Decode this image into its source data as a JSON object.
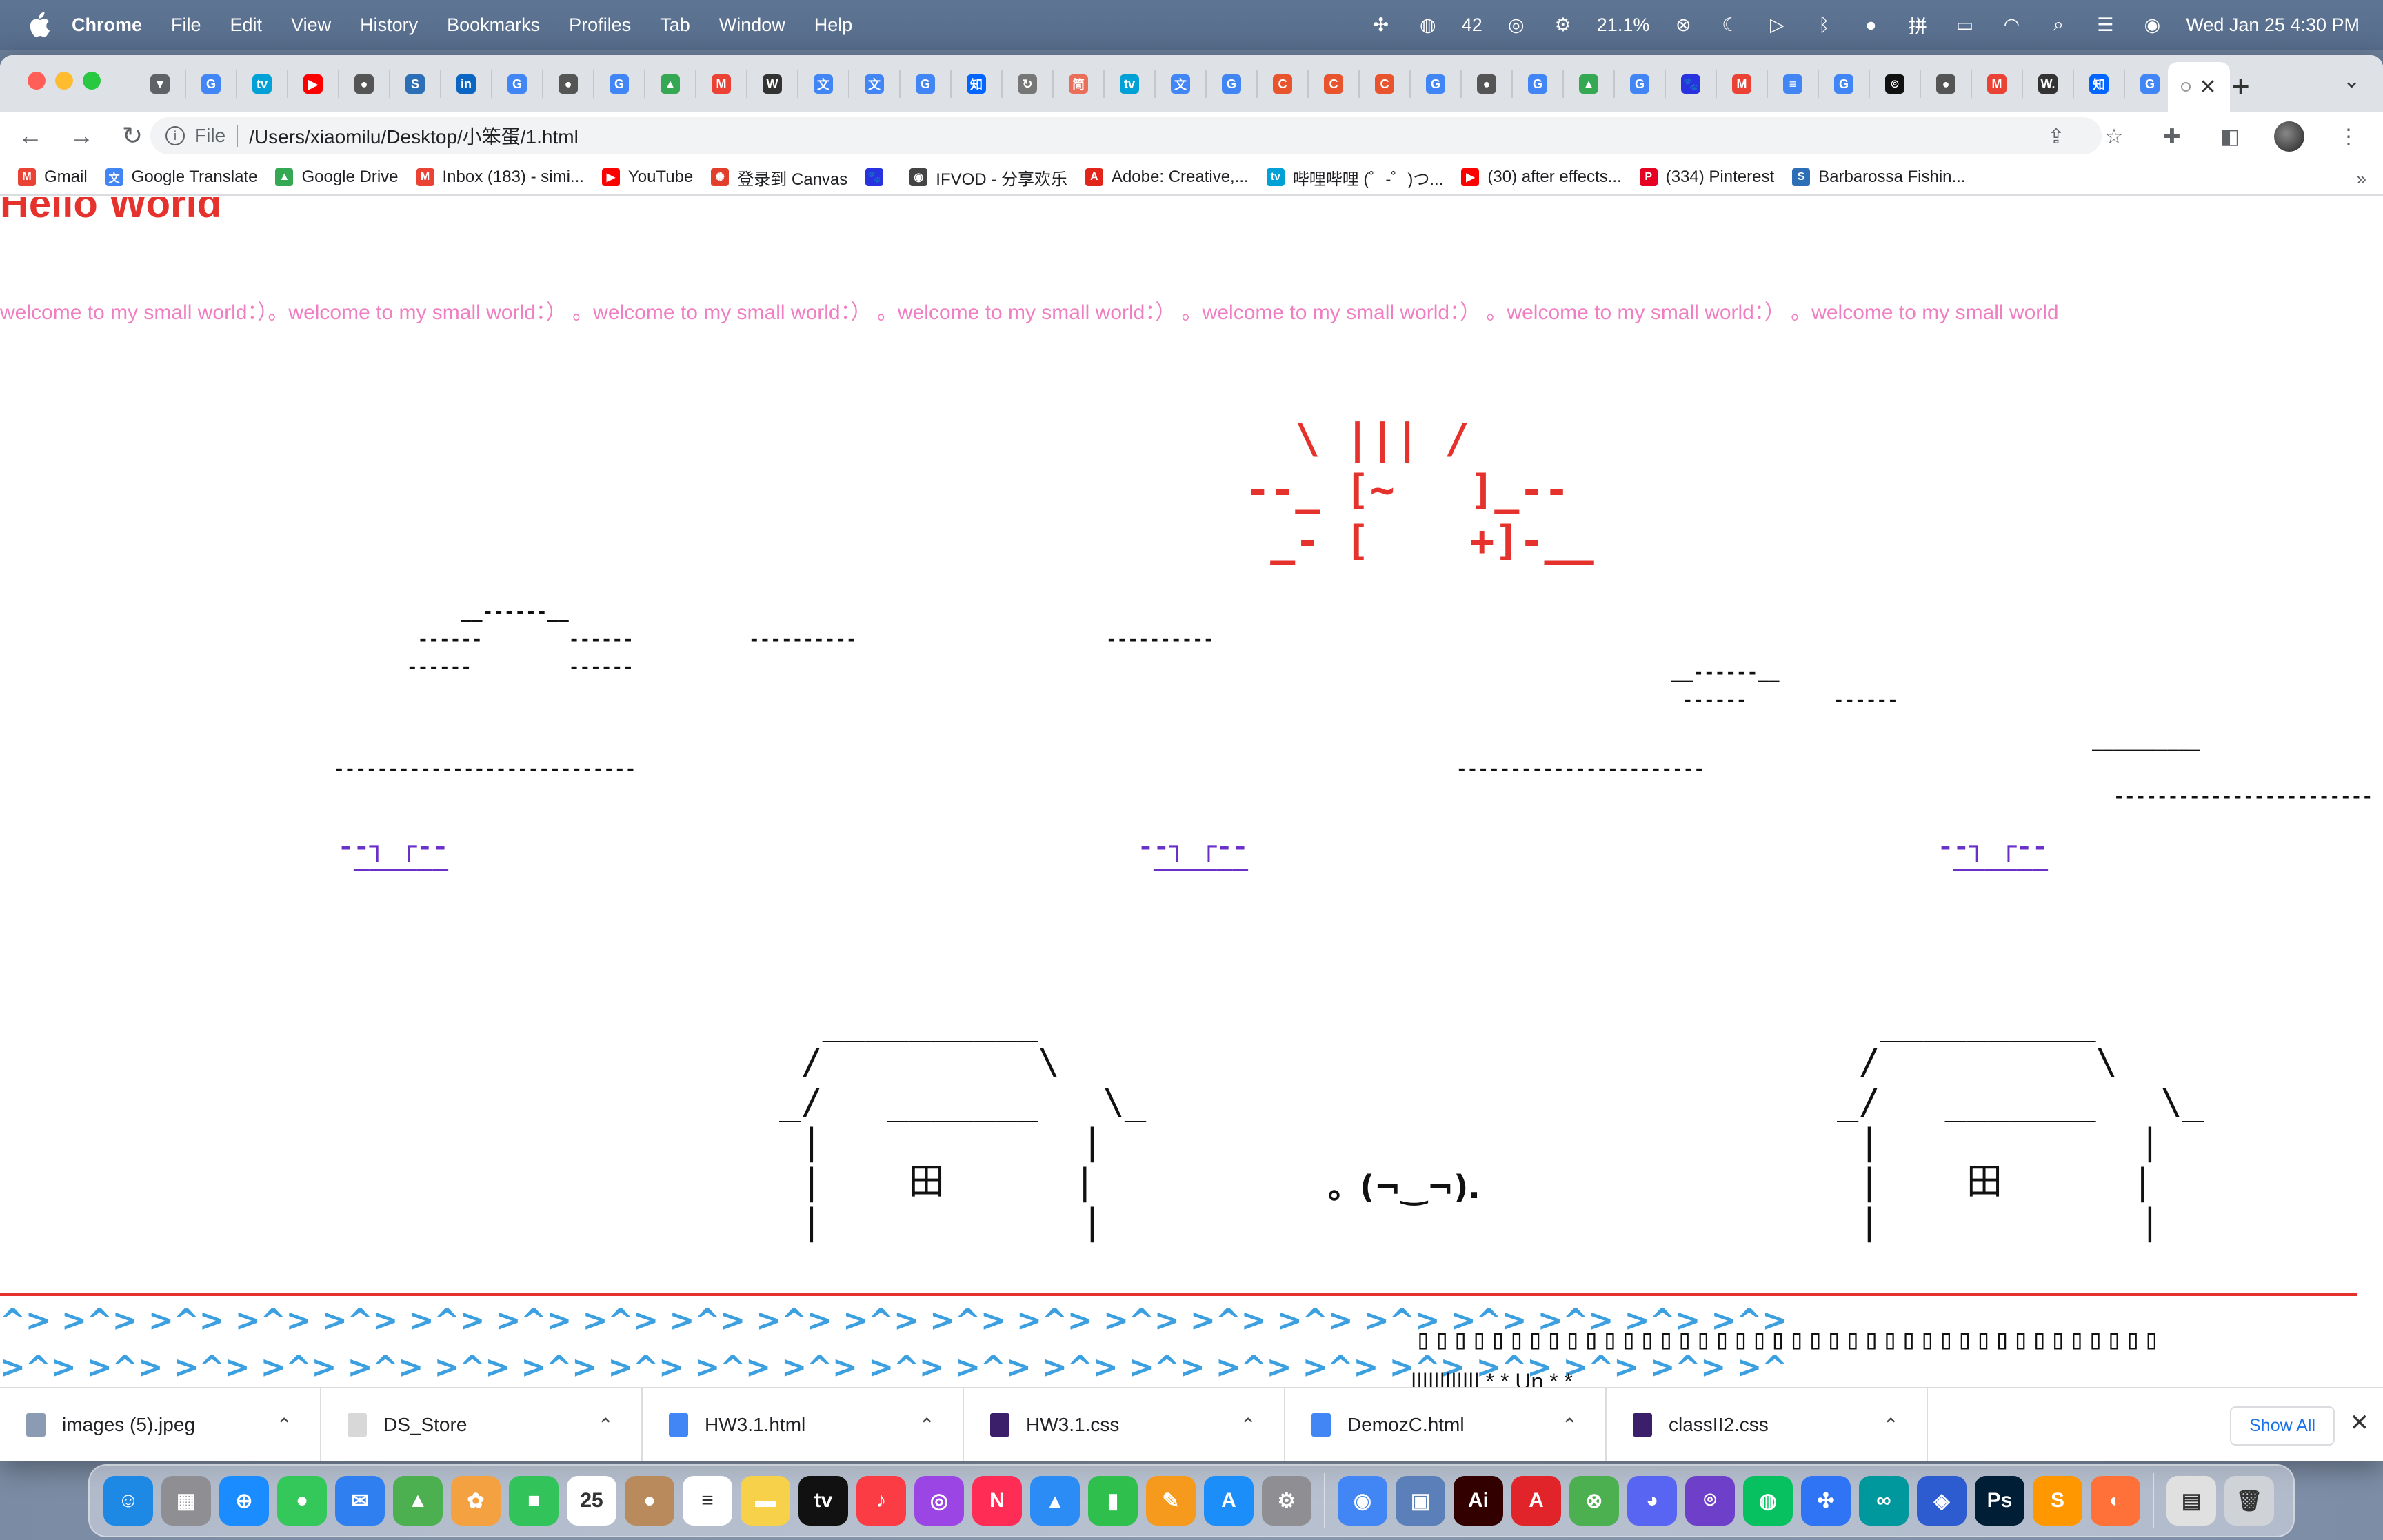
{
  "menubar": {
    "app": "Chrome",
    "items": [
      "File",
      "Edit",
      "View",
      "History",
      "Bookmarks",
      "Profiles",
      "Tab",
      "Window",
      "Help"
    ],
    "wechat_count": "42",
    "cpu": "21.1%",
    "datetime": "Wed Jan 25  4:30 PM"
  },
  "tabs": {
    "favicons": [
      {
        "label": "▼",
        "color": "#5f6368"
      },
      {
        "label": "G",
        "color": "#4285f4"
      },
      {
        "label": "tv",
        "color": "#00a1d6"
      },
      {
        "label": "▶",
        "color": "#ff0000"
      },
      {
        "label": "●",
        "color": "#555"
      },
      {
        "label": "S",
        "color": "#2d6fb7"
      },
      {
        "label": "in",
        "color": "#0a66c2"
      },
      {
        "label": "G",
        "color": "#4285f4"
      },
      {
        "label": "●",
        "color": "#555"
      },
      {
        "label": "G",
        "color": "#4285f4"
      },
      {
        "label": "▲",
        "color": "#34a853"
      },
      {
        "label": "M",
        "color": "#ea4335"
      },
      {
        "label": "W",
        "color": "#333"
      },
      {
        "label": "文",
        "color": "#4285f4"
      },
      {
        "label": "文",
        "color": "#4285f4"
      },
      {
        "label": "G",
        "color": "#4285f4"
      },
      {
        "label": "知",
        "color": "#0066ff"
      },
      {
        "label": "↻",
        "color": "#777"
      },
      {
        "label": "简",
        "color": "#ea6f5a"
      },
      {
        "label": "tv",
        "color": "#00a1d6"
      },
      {
        "label": "文",
        "color": "#4285f4"
      },
      {
        "label": "G",
        "color": "#4285f4"
      },
      {
        "label": "C",
        "color": "#e8542d"
      },
      {
        "label": "C",
        "color": "#e8542d"
      },
      {
        "label": "C",
        "color": "#e8542d"
      },
      {
        "label": "G",
        "color": "#4285f4"
      },
      {
        "label": "●",
        "color": "#555"
      },
      {
        "label": "G",
        "color": "#4285f4"
      },
      {
        "label": "▲",
        "color": "#34a853"
      },
      {
        "label": "G",
        "color": "#4285f4"
      },
      {
        "label": "🐾",
        "color": "#2932e1"
      },
      {
        "label": "M",
        "color": "#ea4335"
      },
      {
        "label": "≡",
        "color": "#4285f4"
      },
      {
        "label": "G",
        "color": "#4285f4"
      },
      {
        "label": "⌾",
        "color": "#111"
      },
      {
        "label": "●",
        "color": "#555"
      },
      {
        "label": "M",
        "color": "#ea4335"
      },
      {
        "label": "W.",
        "color": "#333"
      },
      {
        "label": "知",
        "color": "#0066ff"
      },
      {
        "label": "G",
        "color": "#4285f4"
      }
    ]
  },
  "toolbar": {
    "scheme": "File",
    "url": "/Users/xiaomilu/Desktop/小笨蛋/1.html"
  },
  "bookmarks": [
    {
      "label": "Gmail",
      "icon": "M",
      "color": "#ea4335"
    },
    {
      "label": "Google Translate",
      "icon": "文",
      "color": "#4285f4"
    },
    {
      "label": "Google Drive",
      "icon": "▲",
      "color": "#34a853"
    },
    {
      "label": "Inbox (183) - simi...",
      "icon": "M",
      "color": "#ea4335"
    },
    {
      "label": "YouTube",
      "icon": "▶",
      "color": "#ff0000"
    },
    {
      "label": "登录到 Canvas",
      "icon": "✺",
      "color": "#e13f2b"
    },
    {
      "label": "",
      "icon": "🐾",
      "color": "#2932e1"
    },
    {
      "label": "IFVOD - 分享欢乐",
      "icon": "◉",
      "color": "#444"
    },
    {
      "label": "Adobe: Creative,...",
      "icon": "A",
      "color": "#e1251b"
    },
    {
      "label": "哔哩哔哩 (゜-゜)つ...",
      "icon": "tv",
      "color": "#00a1d6"
    },
    {
      "label": "(30) after effects...",
      "icon": "▶",
      "color": "#ff0000"
    },
    {
      "label": "(334) Pinterest",
      "icon": "P",
      "color": "#e60023"
    },
    {
      "label": "Barbarossa Fishin...",
      "icon": "S",
      "color": "#2d6fb7"
    }
  ],
  "page": {
    "title": "Hello World",
    "marquee": "welcome to my small world：）。welcome to my small world：）  。welcome to my small world：）  。welcome to my small world：）  。welcome to my small world：）  。welcome to my small world：）  。welcome to my small world",
    "sun": "  \\ ||| /\n--_ [~   ]_--\n _- [    +]-__",
    "cloud1": "     __------__\n ------        ------\n------         ------",
    "cloud2": "----------",
    "cloud3": "----------",
    "cloud4": "__------__\n ------        ------",
    "ground1": "----------------------------",
    "ground2": "-----------------------",
    "ground3": "__________\n\n  ------------------------",
    "bird": "--┐ ┌--\n ‾‾‾‾‾‾",
    "house": "  __________\n /          \\\n_/   _______   \\_\n |            |\n |    田      |\n |            |",
    "face": "。(¬‿¬).",
    "carets1": "^> >^> >^> >^> >^> >^> >^> >^> >^> >^> >^> >^> >^> >^> >^> >^> >^> >^> >^> >^> >^>",
    "carets2": ">^> >^> >^> >^> >^> >^> >^> >^> >^> >^> >^> >^> >^> >^> >^> >^> >^> >^> >^> >^> >^",
    "carets3": "^%^ ^$^ ^#^ ^@^ ^!^ ^&^ ^%^ ^$^ ^#^ ^@^ ^!^ ^&^ ^%^ ^$^ ^#^ ^@^ ^!^ ^&^ ^%^ ^$^",
    "boxes": "▯▯▯▯▯▯▯▯▯▯▯▯▯▯▯▯▯▯▯▯▯▯▯▯▯▯▯▯▯▯▯▯▯▯▯▯▯▯▯▯",
    "pipes": "|||||||||||| * * Un * *"
  },
  "downloads": {
    "items": [
      {
        "name": "images (5).jpeg",
        "color": "#8a9bb3"
      },
      {
        "name": "DS_Store",
        "color": "#d8d8d8"
      },
      {
        "name": "HW3.1.html",
        "color": "#4285f4"
      },
      {
        "name": "HW3.1.css",
        "color": "#3b1f6b"
      },
      {
        "name": "DemozC.html",
        "color": "#4285f4"
      },
      {
        "name": "classII2.css",
        "color": "#3b1f6b"
      }
    ],
    "show_all": "Show All"
  },
  "dock": {
    "apps": [
      {
        "name": "finder",
        "label": "☺",
        "color": "#1e88e5"
      },
      {
        "name": "launchpad",
        "label": "▦",
        "color": "#8e8e93"
      },
      {
        "name": "safari",
        "label": "⊕",
        "color": "#1a8cff"
      },
      {
        "name": "messages",
        "label": "●",
        "color": "#34c759"
      },
      {
        "name": "mail",
        "label": "✉",
        "color": "#2f7ff0"
      },
      {
        "name": "maps",
        "label": "▲",
        "color": "#4caf50"
      },
      {
        "name": "photos",
        "label": "✿",
        "color": "#f4a142"
      },
      {
        "name": "facetime",
        "label": "■",
        "color": "#32c45a"
      },
      {
        "name": "calendar",
        "label": "25",
        "color": "#ffffff"
      },
      {
        "name": "contacts",
        "label": "●",
        "color": "#b98a5b"
      },
      {
        "name": "reminders",
        "label": "≡",
        "color": "#ffffff"
      },
      {
        "name": "notes",
        "label": "▬",
        "color": "#f7d14a"
      },
      {
        "name": "tv",
        "label": "tv",
        "color": "#111111"
      },
      {
        "name": "music",
        "label": "♪",
        "color": "#fc3c44"
      },
      {
        "name": "podcasts",
        "label": "◎",
        "color": "#9b45e4"
      },
      {
        "name": "news",
        "label": "N",
        "color": "#ff2d55"
      },
      {
        "name": "keynote",
        "label": "▴",
        "color": "#2b8cf5"
      },
      {
        "name": "numbers",
        "label": "▮",
        "color": "#2fbf4c"
      },
      {
        "name": "pages",
        "label": "✎",
        "color": "#f69a1d"
      },
      {
        "name": "appstore",
        "label": "A",
        "color": "#1c8ef9"
      },
      {
        "name": "settings",
        "label": "⚙",
        "color": "#8e8e93"
      },
      {
        "name": "chrome",
        "label": "◉",
        "color": "#4285f4"
      },
      {
        "name": "preview",
        "label": "▣",
        "color": "#5b7fb8"
      },
      {
        "name": "illustrator",
        "label": "Ai",
        "color": "#330000"
      },
      {
        "name": "acrobat",
        "label": "A",
        "color": "#e0242a"
      },
      {
        "name": "network",
        "label": "⊗",
        "color": "#4caf50"
      },
      {
        "name": "discord",
        "label": "◕",
        "color": "#5865f2"
      },
      {
        "name": "github",
        "label": "⌾",
        "color": "#6e40c9"
      },
      {
        "name": "wechat",
        "label": "◍",
        "color": "#07c160"
      },
      {
        "name": "baidu",
        "label": "✣",
        "color": "#2f74f5"
      },
      {
        "name": "arduino",
        "label": "∞",
        "color": "#00979d"
      },
      {
        "name": "vpn",
        "label": "◈",
        "color": "#2d5bd0"
      },
      {
        "name": "photoshop",
        "label": "Ps",
        "color": "#001e36"
      },
      {
        "name": "sublime",
        "label": "S",
        "color": "#ff9800"
      },
      {
        "name": "firefox",
        "label": "◐",
        "color": "#ff7139"
      },
      {
        "name": "document",
        "label": "▤",
        "color": "#e0e0e0"
      },
      {
        "name": "trash",
        "label": "🗑",
        "color": "#cfd3d8"
      }
    ]
  }
}
